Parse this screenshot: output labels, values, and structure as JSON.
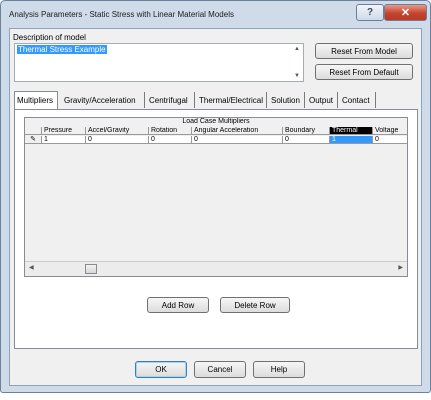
{
  "window": {
    "title": "Analysis Parameters - Static Stress with Linear Material Models"
  },
  "titlebar_buttons": {
    "help": "?",
    "close": "✕"
  },
  "description": {
    "label": "Description of model",
    "value": "Thermal Stress Example"
  },
  "side_buttons": {
    "reset_model": "Reset From Model",
    "reset_default": "Reset From Default"
  },
  "tabs": [
    "Multipliers",
    "Gravity/Acceleration",
    "Centrifugal",
    "Thermal/Electrical",
    "Solution",
    "Output",
    "Contact"
  ],
  "active_tab": "Multipliers",
  "grid": {
    "title": "Load Case Multipliers",
    "columns": [
      "",
      "Pressure",
      "Accel/Gravity",
      "Rotation",
      "Angular Acceleration",
      "Boundary",
      "Thermal",
      "Voltage"
    ],
    "rows": [
      [
        "✎",
        "1",
        "0",
        "0",
        "0",
        "0",
        "1",
        "0"
      ]
    ],
    "selected_column": "Thermal"
  },
  "panel_buttons": {
    "add_row": "Add Row",
    "delete_row": "Delete Row"
  },
  "dialog_buttons": {
    "ok": "OK",
    "cancel": "Cancel",
    "help": "Help"
  }
}
